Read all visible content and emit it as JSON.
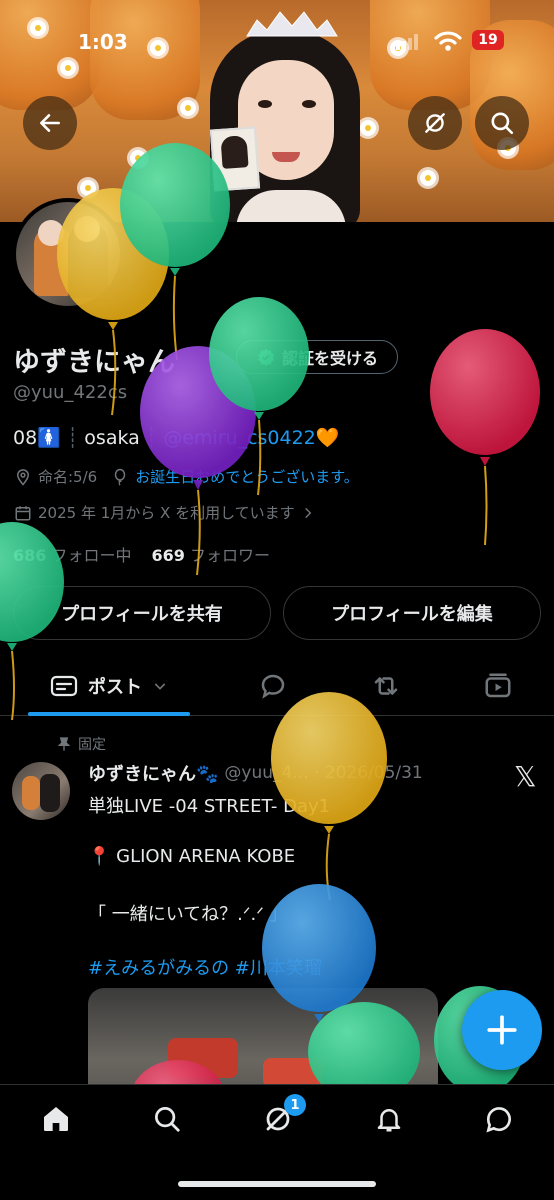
{
  "status_bar": {
    "time": "1:03",
    "battery": "19"
  },
  "profile": {
    "display_name": "ゆずきにゃん",
    "verify_label": "認証を受ける",
    "handle": "@yuu_422cs",
    "bio_prefix": "08🚺",
    "bio_location": "osaka",
    "bio_mention": "@emiru_cs0422🧡",
    "meta_name_day": "命名:5/6",
    "meta_birthday": "お誕生日おめでとうございます。",
    "meta_joined": "2025 年 1月から X を利用しています",
    "following_count": "686",
    "following_label": "フォロー中",
    "followers_count": "669",
    "followers_label": "フォロワー",
    "share_label": "プロフィールを共有",
    "edit_label": "プロフィールを編集"
  },
  "tabs": {
    "posts_label": "ポスト"
  },
  "post": {
    "pinned_label": "固定",
    "author_name": "ゆずきにゃん🐾",
    "author_handle": "@yuu_4... · 2026/05/31",
    "line_1": "単独LIVE -04 STREET- Day1",
    "line_2": "📍 GLION ARENA KOBE",
    "line_3": "「 一緒にいてね？.ᐟ.ᐟ 」",
    "tags": "#えみるがみるの  #川本笑瑠"
  },
  "nav": {
    "grok_badge": "1"
  },
  "colors": {
    "accent": "#1d9bf0",
    "background": "#000000",
    "text_secondary": "#71767b",
    "balloon_yellow": "#e8b923",
    "balloon_green": "#2ec98a",
    "balloon_purple": "#8a2bd1",
    "balloon_red": "#e0284f",
    "balloon_blue": "#2a8fe0"
  },
  "icons": [
    "back-arrow-icon",
    "hide-icon",
    "search-icon",
    "verified-badge-icon",
    "location-icon",
    "balloon-icon",
    "calendar-icon",
    "chevron-right-icon",
    "posts-icon",
    "chevron-down-icon",
    "reply-icon",
    "repost-icon",
    "media-icon",
    "pin-icon",
    "x-logo-icon",
    "plus-icon",
    "home-icon",
    "grok-icon",
    "bell-icon",
    "messages-icon"
  ]
}
